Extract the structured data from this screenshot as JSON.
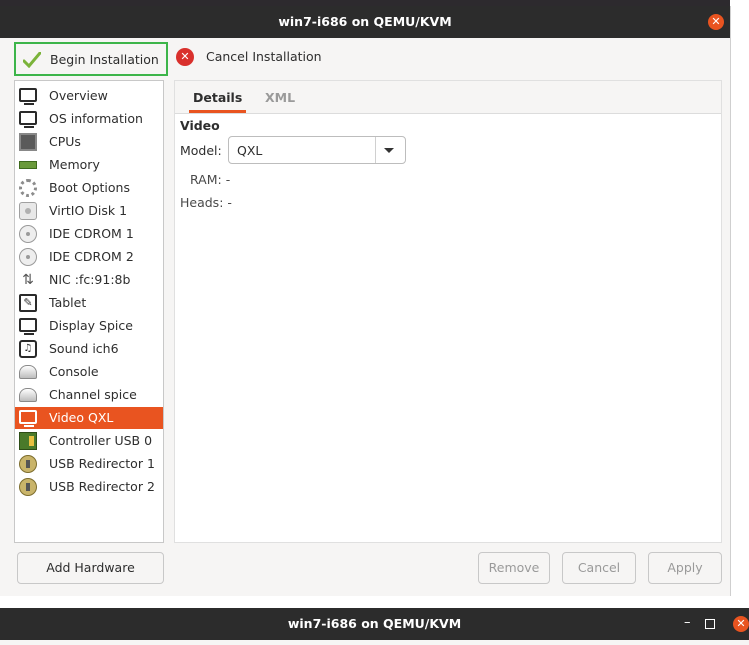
{
  "window": {
    "title": "win7-i686 on QEMU/KVM"
  },
  "toolbar": {
    "begin_label": "Begin Installation",
    "cancel_label": "Cancel Installation"
  },
  "sidebar": {
    "items": [
      {
        "label": "Overview",
        "icon": "monitor-icon"
      },
      {
        "label": "OS information",
        "icon": "monitor-icon"
      },
      {
        "label": "CPUs",
        "icon": "cpu-icon"
      },
      {
        "label": "Memory",
        "icon": "memory-icon"
      },
      {
        "label": "Boot Options",
        "icon": "gear-icon"
      },
      {
        "label": "VirtIO Disk 1",
        "icon": "disk-icon"
      },
      {
        "label": "IDE CDROM 1",
        "icon": "cdrom-icon"
      },
      {
        "label": "IDE CDROM 2",
        "icon": "cdrom-icon"
      },
      {
        "label": "NIC :fc:91:8b",
        "icon": "network-icon"
      },
      {
        "label": "Tablet",
        "icon": "tablet-icon"
      },
      {
        "label": "Display Spice",
        "icon": "monitor-icon"
      },
      {
        "label": "Sound ich6",
        "icon": "sound-icon"
      },
      {
        "label": "Console",
        "icon": "console-icon"
      },
      {
        "label": "Channel spice",
        "icon": "console-icon"
      },
      {
        "label": "Video QXL",
        "icon": "monitor-icon",
        "selected": true
      },
      {
        "label": "Controller USB 0",
        "icon": "usb-controller-icon"
      },
      {
        "label": "USB Redirector 1",
        "icon": "usb-redirector-icon"
      },
      {
        "label": "USB Redirector 2",
        "icon": "usb-redirector-icon"
      }
    ]
  },
  "tabs": {
    "details": "Details",
    "xml": "XML"
  },
  "video": {
    "section_title": "Video",
    "model_label": "Model:",
    "model_value": "QXL",
    "ram_label": "RAM:",
    "ram_value": "-",
    "heads_label": "Heads:",
    "heads_value": "-"
  },
  "buttons": {
    "add_hardware": "Add Hardware",
    "remove": "Remove",
    "cancel": "Cancel",
    "apply": "Apply"
  },
  "second_window": {
    "title": "win7-i686 on QEMU/KVM"
  },
  "colors": {
    "accent": "#e95420",
    "titlebar": "#2c2c2c",
    "highlight_border": "#3db54a"
  }
}
